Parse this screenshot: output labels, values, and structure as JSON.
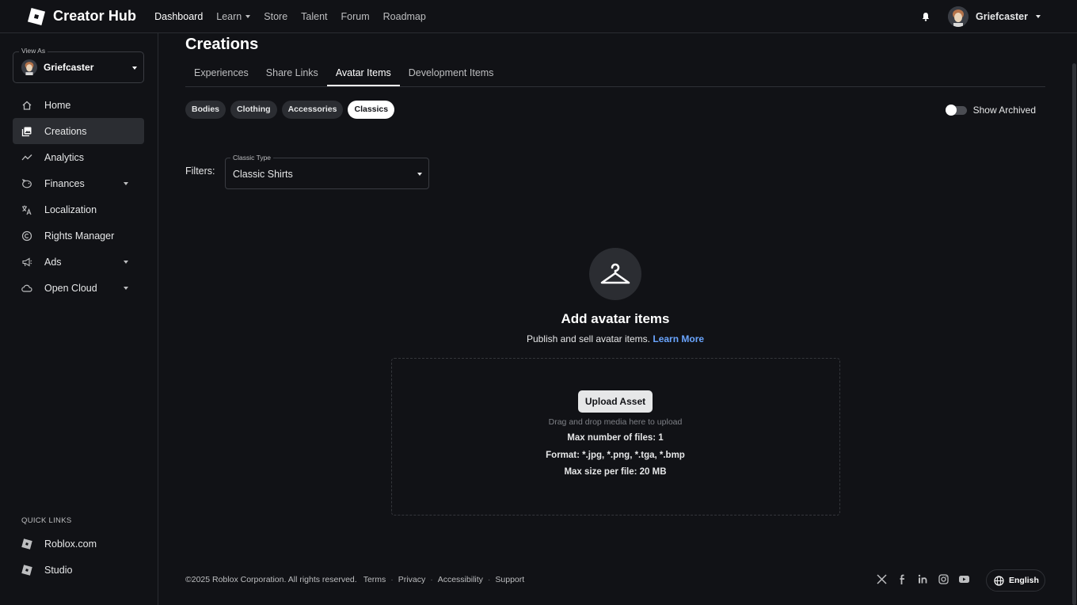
{
  "topnav": {
    "brand": "Creator Hub",
    "links": [
      {
        "label": "Dashboard"
      },
      {
        "label": "Learn"
      },
      {
        "label": "Store"
      },
      {
        "label": "Talent"
      },
      {
        "label": "Forum"
      },
      {
        "label": "Roadmap"
      }
    ],
    "user": "Griefcaster"
  },
  "sidebar": {
    "view_as_label": "View As",
    "view_as_name": "Griefcaster",
    "items": [
      {
        "label": "Home",
        "icon": "home-icon"
      },
      {
        "label": "Creations",
        "icon": "creations-icon"
      },
      {
        "label": "Analytics",
        "icon": "analytics-icon"
      },
      {
        "label": "Finances",
        "icon": "finances-icon"
      },
      {
        "label": "Localization",
        "icon": "localization-icon"
      },
      {
        "label": "Rights Manager",
        "icon": "rights-icon"
      },
      {
        "label": "Ads",
        "icon": "megaphone-icon"
      },
      {
        "label": "Open Cloud",
        "icon": "cloud-icon"
      }
    ],
    "quick_links_title": "QUICK LINKS",
    "quick_links": [
      {
        "label": "Roblox.com"
      },
      {
        "label": "Studio"
      }
    ]
  },
  "main": {
    "title": "Creations",
    "tabs": [
      {
        "label": "Experiences"
      },
      {
        "label": "Share Links"
      },
      {
        "label": "Avatar Items"
      },
      {
        "label": "Development Items"
      }
    ],
    "chips": [
      {
        "label": "Bodies"
      },
      {
        "label": "Clothing"
      },
      {
        "label": "Accessories"
      },
      {
        "label": "Classics"
      }
    ],
    "show_archived": "Show Archived",
    "filters_label": "Filters:",
    "classic_type_label": "Classic Type",
    "classic_type_value": "Classic Shirts",
    "empty_title": "Add avatar items",
    "empty_subtitle": "Publish and sell avatar items.",
    "learn_more": "Learn More",
    "upload_button": "Upload Asset",
    "drop_hint": "Drag and drop media here to upload",
    "max_files": "Max number of files: 1",
    "format": "Format: *.jpg, *.png, *.tga, *.bmp",
    "max_size": "Max size per file: 20 MB"
  },
  "footer": {
    "copyright": "©2025 Roblox Corporation. All rights reserved.",
    "links": [
      {
        "label": "Terms"
      },
      {
        "label": "Privacy"
      },
      {
        "label": "Accessibility"
      },
      {
        "label": "Support"
      }
    ],
    "language": "English",
    "socials": [
      "x-icon",
      "facebook-icon",
      "linkedin-icon",
      "instagram-icon",
      "youtube-icon"
    ]
  },
  "colors": {
    "background": "#111216",
    "active_item": "#2b2d32",
    "link": "#6aa5ff"
  }
}
